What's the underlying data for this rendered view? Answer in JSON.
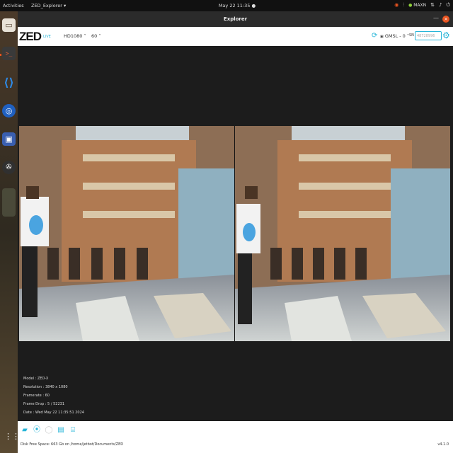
{
  "topbar": {
    "activities": "Activities",
    "app_menu": "ZED_Explorer",
    "clock": "May 22  11:35",
    "maxn": "MAXN"
  },
  "window": {
    "title": "Explorer"
  },
  "toolbar": {
    "logo": "ZED",
    "live": "LIVE",
    "resolution": "HD1080",
    "fps": "60",
    "camera": "GMSL - 0",
    "sn_label": "SN",
    "sn_value": "48728996"
  },
  "info": {
    "model": "Model : ZED-X",
    "resolution": "Resolution : 3840 x 1080",
    "framerate": "Framerate : 60",
    "frame_drop": "Frame Drop : 5 / 52231",
    "date": "Date : Wed May 22 11:35:51 2024"
  },
  "footer": {
    "disk": "Disk Free Space: 663 Gb on /home/jetbot/Documents/ZED",
    "version": "v4.1.0"
  },
  "colors": {
    "accent": "#27b5d8",
    "ubuntu_orange": "#e95420"
  },
  "icons": {
    "dock": [
      "files-icon",
      "terminal-icon",
      "vscode-icon",
      "chromium-icon",
      "screenshot-app-icon",
      "obs-icon",
      "app-thumbnail-icon",
      "app-grid-icon"
    ],
    "bottom": [
      "folder-icon",
      "broadcast-icon",
      "record-icon",
      "svo-icon",
      "snapshot-icon"
    ]
  }
}
